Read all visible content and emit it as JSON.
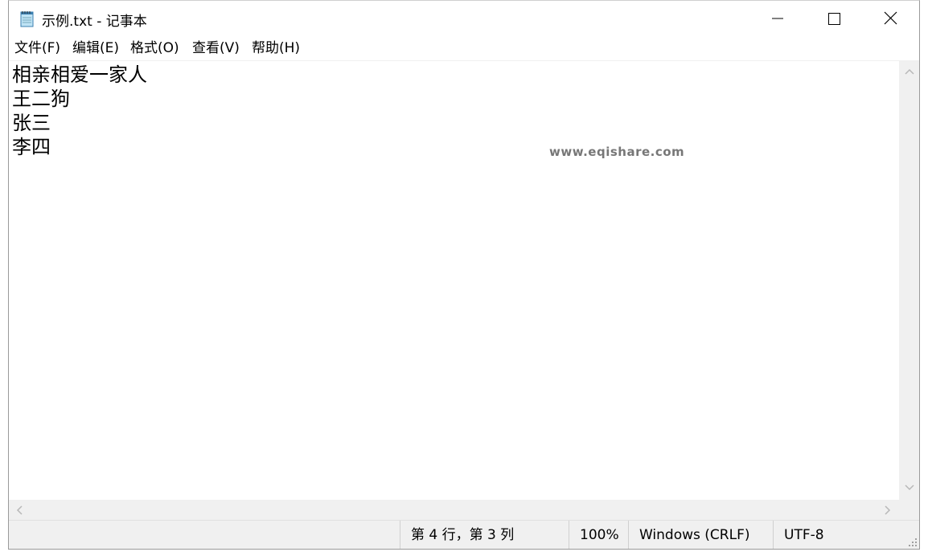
{
  "window": {
    "title": "示例.txt - 记事本",
    "icon": "notepad-icon",
    "controls": {
      "minimize": "minimize-icon",
      "maximize": "maximize-icon",
      "close": "close-icon"
    }
  },
  "menu": {
    "items": [
      "文件(F)",
      "编辑(E)",
      "格式(O)",
      "查看(V)",
      "帮助(H)"
    ]
  },
  "editor": {
    "lines": [
      "相亲相爱一家人",
      "王二狗",
      "张三",
      "李四"
    ],
    "watermark": "www.eqishare.com"
  },
  "status": {
    "position": "第 4 行，第 3 列",
    "zoom": "100%",
    "line_ending": "Windows (CRLF)",
    "encoding": "UTF-8"
  },
  "colors": {
    "chrome_bg": "#f0f0f0",
    "text": "#000000",
    "editor_bg": "#ffffff"
  }
}
